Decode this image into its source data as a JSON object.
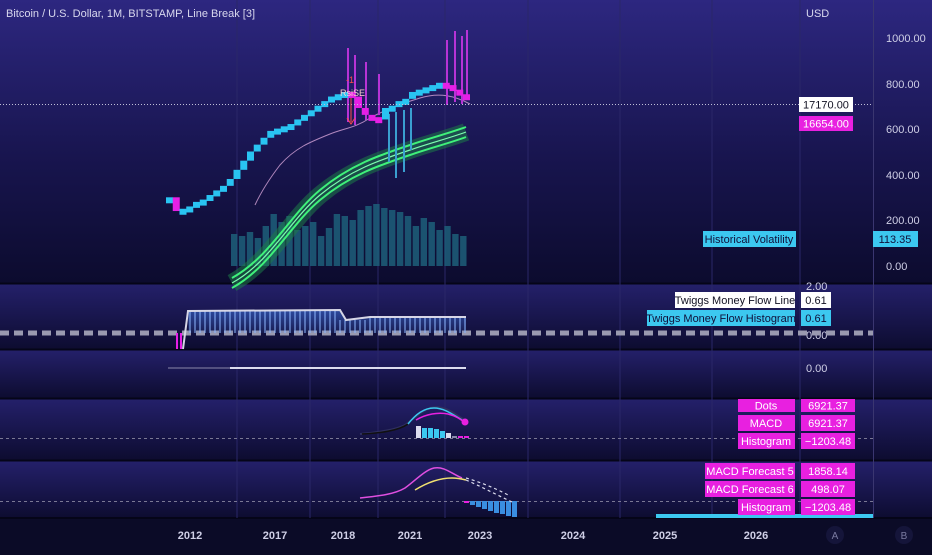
{
  "header": {
    "symbol_title": "Bitcoin / U.S. Dollar, 1M, BITSTAMP, Line Break [3]",
    "currency": "USD"
  },
  "price_axis": {
    "ticks": [
      "1000.00",
      "800.00",
      "600.00",
      "400.00",
      "200.00",
      "0.00"
    ]
  },
  "markers": {
    "rsi_small": "-1",
    "rsi_label": "RsiSE"
  },
  "chart_data": [
    {
      "type": "line",
      "pane": "main",
      "title": "Bitcoin / U.S. Dollar, 1M, BITSTAMP, Line Break [3]",
      "ylabel": "USD",
      "yticks": [
        0,
        200,
        400,
        600,
        800,
        1000
      ],
      "ylim": [
        -20,
        1110
      ],
      "xticks": [
        "2012",
        "2017",
        "2018",
        "2021",
        "2023",
        "2024",
        "2025",
        "2026"
      ],
      "line_break_close": [
        300,
        240,
        250,
        260,
        280,
        290,
        310,
        330,
        350,
        380,
        420,
        460,
        500,
        530,
        560,
        590,
        600,
        610,
        620,
        640,
        660,
        680,
        700,
        720,
        740,
        750,
        760,
        740,
        690,
        660,
        650,
        640,
        690,
        700,
        720,
        730,
        760,
        770,
        780,
        790,
        800,
        790,
        770,
        750,
        740
      ],
      "price_labels": [
        {
          "label": "17170.00",
          "style": "white"
        },
        {
          "label": "16654.00",
          "style": "magenta"
        }
      ],
      "indicator_labels": [
        {
          "name": "Historical Volatility",
          "value": "113.35"
        }
      ],
      "grid": true
    },
    {
      "type": "area",
      "pane": "money_flow",
      "ytick_labels": [
        "2.00",
        "0.00"
      ],
      "series": [
        {
          "name": "Twiggs Money Flow Line",
          "value_label": "0.61"
        },
        {
          "name": "Twiggs Money Flow Histogram",
          "value_label": "0.61"
        }
      ]
    },
    {
      "type": "line",
      "pane": "flat",
      "ytick_labels": [
        "0.00"
      ]
    },
    {
      "type": "line",
      "pane": "macd",
      "series": [
        {
          "name": "Dots",
          "value_label": "6921.37"
        },
        {
          "name": "MACD",
          "value_label": "6921.37"
        },
        {
          "name": "Histogram",
          "value_label": "−1203.48"
        }
      ]
    },
    {
      "type": "line",
      "pane": "macd_forecast",
      "series": [
        {
          "name": "MACD Forecast 5",
          "value_label": "1858.14"
        },
        {
          "name": "MACD Forecast 6",
          "value_label": "498.07"
        },
        {
          "name": "Histogram",
          "value_label": "−1203.48"
        }
      ]
    }
  ],
  "time_axis": {
    "labels": [
      "2012",
      "2017",
      "2018",
      "2021",
      "2023",
      "2024",
      "2025",
      "2026"
    ]
  },
  "scale_buttons": {
    "a": "A",
    "b": "B"
  },
  "colors": {
    "background_top": "#2a2577",
    "background_bottom": "#0b0b2c",
    "brick_up": "#29c4f2",
    "brick_down": "#e61fe6",
    "magenta_label": "#e820e0",
    "cyan_label": "#3cc8f0",
    "ma_green": "#3ff17a"
  }
}
